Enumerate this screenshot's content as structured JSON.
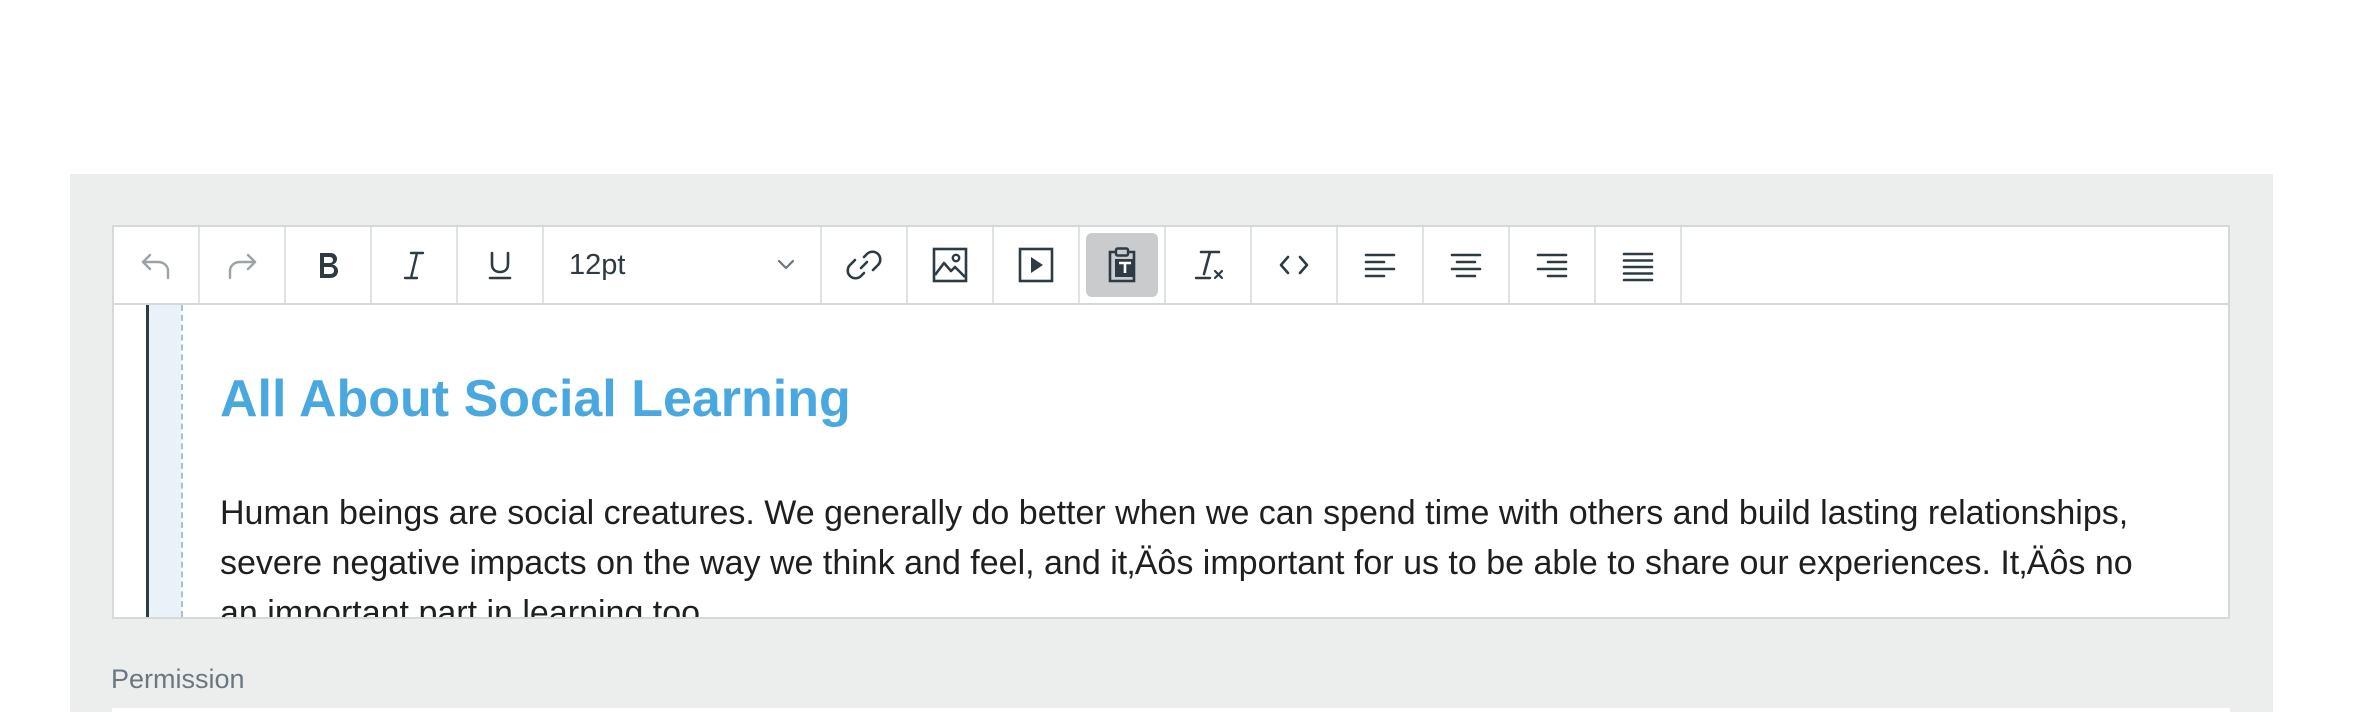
{
  "toolbar": {
    "buttons": [
      {
        "name": "undo-button",
        "icon": "undo-icon"
      },
      {
        "name": "redo-button",
        "icon": "redo-icon"
      },
      {
        "name": "bold-button",
        "icon": "bold-icon"
      },
      {
        "name": "italic-button",
        "icon": "italic-icon"
      },
      {
        "name": "underline-button",
        "icon": "underline-icon"
      }
    ],
    "font_size": "12pt",
    "pressed_button": "paste-text-button"
  },
  "content": {
    "heading": "All About Social Learning",
    "paragraph_lines": [
      "Human beings are social creatures. We generally do better when we can spend time with others and build lasting relationships,",
      "severe negative impacts on the way we think and feel, and it‚Äôs important for us to be able to share our experiences. It‚Äôs no",
      "an important part in learning too."
    ]
  },
  "permission": {
    "label": "Permission"
  },
  "colors": {
    "panel_bg": "#eceeee",
    "heading": "#4aa8e0",
    "pressed_bg": "#c9cbcd",
    "text": "#2d3b45"
  }
}
